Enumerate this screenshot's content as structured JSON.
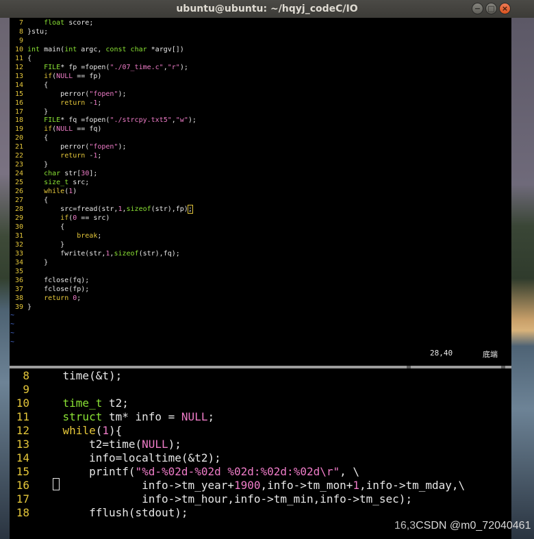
{
  "window": {
    "title": "ubuntu@ubuntu: ~/hqyj_codeC/IO",
    "buttons": {
      "minimize": "−",
      "maximize": "□",
      "close": "×"
    }
  },
  "top_pane": {
    "lines": [
      {
        "n": "7",
        "t": "    float score;"
      },
      {
        "n": "8",
        "t": "}stu;"
      },
      {
        "n": "9",
        "t": ""
      },
      {
        "n": "10",
        "t": "int main(int argc, const char *argv[])"
      },
      {
        "n": "11",
        "t": "{"
      },
      {
        "n": "12",
        "t": "    FILE* fp =fopen(\"./07_time.c\",\"r\");"
      },
      {
        "n": "13",
        "t": "    if(NULL == fp)"
      },
      {
        "n": "14",
        "t": "    {"
      },
      {
        "n": "15",
        "t": "        perror(\"fopen\");"
      },
      {
        "n": "16",
        "t": "        return -1;"
      },
      {
        "n": "17",
        "t": "    }"
      },
      {
        "n": "18",
        "t": "    FILE* fq =fopen(\"./strcpy.txt5\",\"w\");"
      },
      {
        "n": "19",
        "t": "    if(NULL == fq)"
      },
      {
        "n": "20",
        "t": "    {"
      },
      {
        "n": "21",
        "t": "        perror(\"fopen\");"
      },
      {
        "n": "22",
        "t": "        return -1;"
      },
      {
        "n": "23",
        "t": "    }"
      },
      {
        "n": "24",
        "t": "    char str[30];"
      },
      {
        "n": "25",
        "t": "    size_t src;"
      },
      {
        "n": "26",
        "t": "    while(1)"
      },
      {
        "n": "27",
        "t": "    {"
      },
      {
        "n": "28",
        "t": "        src=fread(str,1,sizeof(str),fp);"
      },
      {
        "n": "29",
        "t": "        if(0 == src)"
      },
      {
        "n": "30",
        "t": "        {"
      },
      {
        "n": "31",
        "t": "            break;"
      },
      {
        "n": "32",
        "t": "        }"
      },
      {
        "n": "33",
        "t": "        fwrite(str,1,sizeof(str),fq);"
      },
      {
        "n": "34",
        "t": "    }"
      },
      {
        "n": "35",
        "t": ""
      },
      {
        "n": "36",
        "t": "    fclose(fq);"
      },
      {
        "n": "37",
        "t": "    fclose(fp);"
      },
      {
        "n": "38",
        "t": "    return 0;"
      },
      {
        "n": "39",
        "t": "}"
      }
    ],
    "tilde": "~",
    "tilde_count": 4,
    "status_pos": "28,40",
    "status_scroll": "底端"
  },
  "bottom_pane": {
    "lines": [
      {
        "n": "8",
        "t": "    time(&t);"
      },
      {
        "n": "9",
        "t": ""
      },
      {
        "n": "10",
        "t": "    time_t t2;"
      },
      {
        "n": "11",
        "t": "    struct tm* info = NULL;"
      },
      {
        "n": "12",
        "t": "    while(1){"
      },
      {
        "n": "13",
        "t": "        t2=time(NULL);"
      },
      {
        "n": "14",
        "t": "        info=localtime(&t2);"
      },
      {
        "n": "15",
        "t": "        printf(\"%d-%02d-%02d %02d:%02d:%02d\\r\", \\"
      },
      {
        "n": "16",
        "t": "                info->tm_year+1900,info->tm_mon+1,info->tm_mday,\\"
      },
      {
        "n": "17",
        "t": "                info->tm_hour,info->tm_min,info->tm_sec);"
      },
      {
        "n": "18",
        "t": "        fflush(stdout);"
      }
    ],
    "status_fragment": "16,3",
    "watermark": "CSDN @m0_72040461"
  },
  "colors": {
    "line_number": "#e5c73a",
    "type_keyword": "#8ae234",
    "control_keyword": "#e5c73a",
    "string_literal": "#ef7cc8",
    "tilde": "#4a6fd9"
  }
}
